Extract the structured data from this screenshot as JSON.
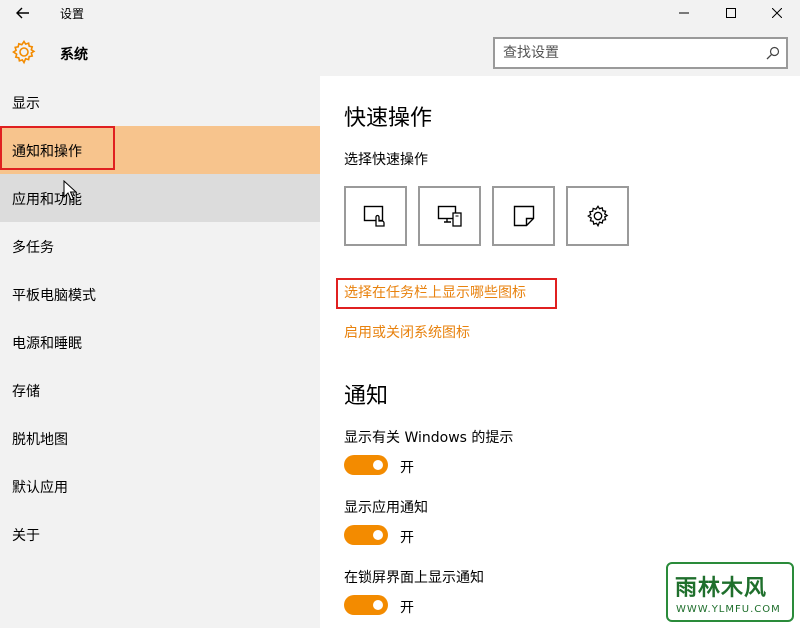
{
  "window": {
    "title": "设置",
    "back_icon": "arrow-left-icon",
    "controls": [
      "minimize-icon",
      "maximize-icon",
      "close-icon"
    ]
  },
  "header": {
    "icon": "gear-icon",
    "icon_color": "#f38b00",
    "title": "系统",
    "search": {
      "value": "",
      "placeholder": "查找设置",
      "icon": "search-icon"
    }
  },
  "sidebar": {
    "items": [
      {
        "label": "显示"
      },
      {
        "label": "通知和操作",
        "selected": true
      },
      {
        "label": "应用和功能",
        "hovered": true
      },
      {
        "label": "多任务"
      },
      {
        "label": "平板电脑模式"
      },
      {
        "label": "电源和睡眠"
      },
      {
        "label": "存储"
      },
      {
        "label": "脱机地图"
      },
      {
        "label": "默认应用"
      },
      {
        "label": "关于"
      }
    ],
    "selected_color": "#f7c48d"
  },
  "main": {
    "quick_actions": {
      "heading": "快速操作",
      "subheading": "选择快速操作",
      "tiles": [
        {
          "icon": "tablet-mode-icon"
        },
        {
          "icon": "connect-icon"
        },
        {
          "icon": "note-icon"
        },
        {
          "icon": "settings-icon"
        }
      ],
      "links": [
        {
          "label": "选择在任务栏上显示哪些图标"
        },
        {
          "label": "启用或关闭系统图标"
        }
      ],
      "link_color": "#e8820e"
    },
    "notifications": {
      "heading": "通知",
      "settings": [
        {
          "label": "显示有关 Windows 的提示",
          "state": "开",
          "on": true
        },
        {
          "label": "显示应用通知",
          "state": "开",
          "on": true
        },
        {
          "label": "在锁屏界面上显示通知",
          "state": "开",
          "on": true
        }
      ],
      "toggle_color": "#f38b00"
    }
  },
  "watermark": {
    "main": "雨林木风",
    "sub": "WWW.YLMFU.COM"
  }
}
